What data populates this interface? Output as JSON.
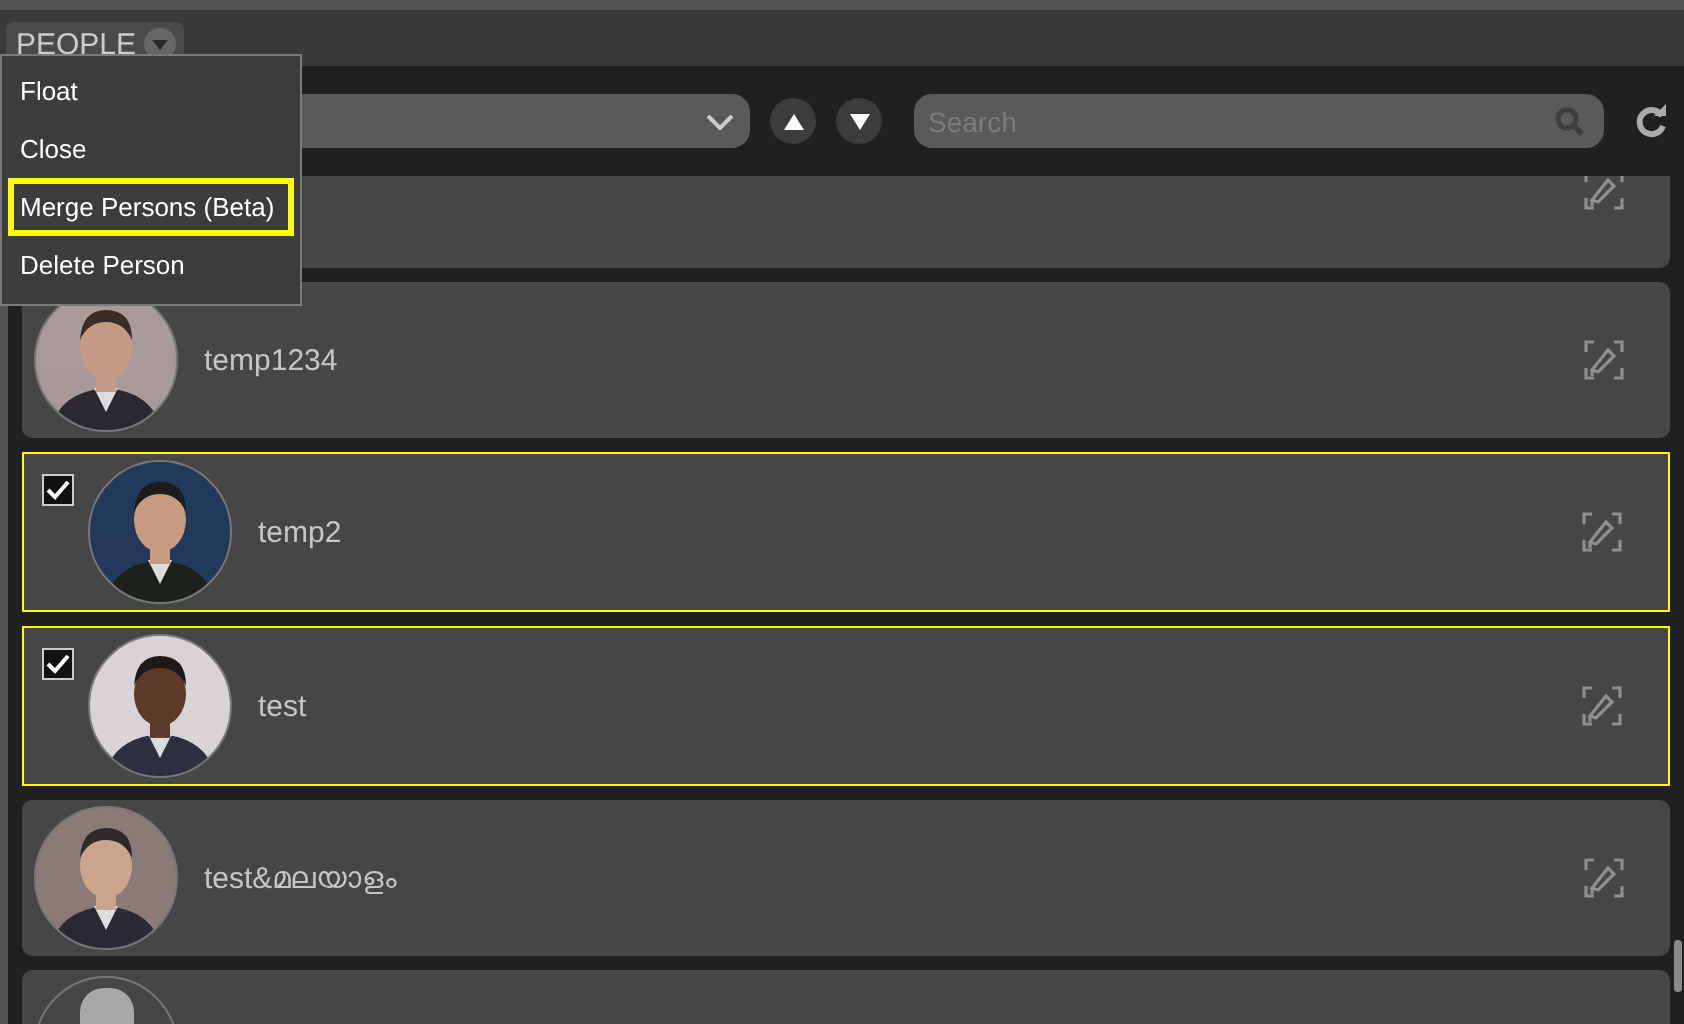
{
  "tab": {
    "label": "PEOPLE"
  },
  "menu": [
    {
      "label": "Float",
      "selected": false
    },
    {
      "label": "Close",
      "selected": false
    },
    {
      "label": "Merge Persons (Beta)",
      "selected": true
    },
    {
      "label": "Delete Person",
      "selected": false
    }
  ],
  "toolbar": {
    "search": {
      "placeholder": "Search"
    }
  },
  "people": [
    {
      "selected": false
    },
    {
      "name": "temp1234",
      "selected": false
    },
    {
      "name": "temp2",
      "selected": true
    },
    {
      "name": "test",
      "selected": true
    },
    {
      "name": "test&മലയാളം",
      "selected": false
    },
    {
      "kind": "silhouette",
      "selected": false
    }
  ]
}
